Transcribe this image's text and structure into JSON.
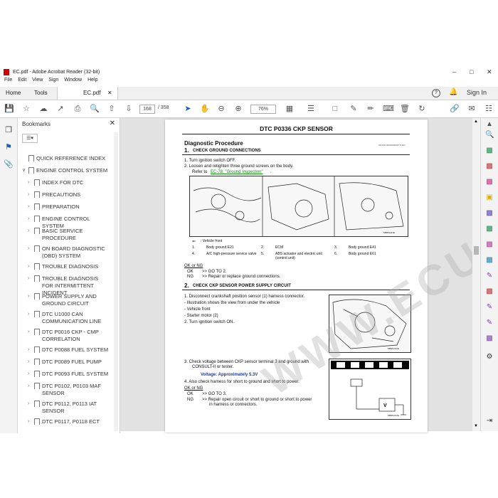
{
  "window": {
    "title": "EC.pdf - Adobe Acrobat Reader (32-bit)",
    "menu": [
      "File",
      "Edit",
      "View",
      "Sign",
      "Window",
      "Help"
    ]
  },
  "tabs": {
    "home": "Home",
    "tools": "Tools",
    "doc": "EC.pdf",
    "sign_in": "Sign In"
  },
  "toolbar": {
    "page_current": "168",
    "page_total": "/ 358",
    "zoom": "76%"
  },
  "bookmarks": {
    "header": "Bookmarks",
    "items": [
      {
        "label": "QUICK REFERENCE INDEX"
      },
      {
        "label": "ENGINE CONTROL SYSTEM"
      },
      {
        "label": "INDEX FOR DTC"
      },
      {
        "label": "PRECAUTIONS"
      },
      {
        "label": "PREPARATION"
      },
      {
        "label": "ENGINE CONTROL SYSTEM"
      },
      {
        "label": "BASIC SERVICE PROCEDURE"
      },
      {
        "label": "ON BOARD DIAGNOSTIC (OBD) SYSTEM"
      },
      {
        "label": "TROUBLE DIAGNOSIS"
      },
      {
        "label": "TROUBLE DIAGNOSIS FOR INTERMITTENT INCIDENT"
      },
      {
        "label": "POWER SUPPLY AND GROUND CIRCUIT"
      },
      {
        "label": "DTC U1000 CAN COMMUNICATION LINE"
      },
      {
        "label": "DTC P0016 CKP - CMP CORRELATION"
      },
      {
        "label": "DTC P0088 FUEL SYSTEM"
      },
      {
        "label": "DTC P0089 FUEL PUMP"
      },
      {
        "label": "DTC P0093 FUEL SYSTEM"
      },
      {
        "label": "DTC P0102, P0103 MAF SENSOR"
      },
      {
        "label": "DTC P0112, P0113 IAT SENSOR"
      },
      {
        "label": "DTC P0117, P0118 ECT"
      }
    ]
  },
  "page": {
    "title": "DTC P0336 CKP SENSOR",
    "section": "Diagnostic Procedure",
    "info_code": "INFOID:0000000005771467",
    "step1": {
      "num": "1.",
      "heading": "CHECK GROUND CONNECTIONS",
      "lines": [
        "1.   Turn ignition switch OFF.",
        "2.   Loosen and retighten three ground screws on the body.",
        "Refer to",
        "EC-78, \"Ground Inspection\"",
        "."
      ],
      "legend_front": ": Vehicle front",
      "legend": [
        [
          "1.",
          "Body ground E21",
          "2.",
          "ECM",
          "3.",
          "Body ground E41"
        ],
        [
          "4.",
          "A/C high-pressure service valve",
          "5.",
          "ABS actuator and electric unit (control unit)",
          "6.",
          "Body ground E61"
        ]
      ],
      "fig_code": "MBIB1221E",
      "ok_ng": "OK or NG",
      "ok": "OK",
      "ok_text": ">> GO TO 2.",
      "ng": "NG",
      "ng_text": ">> Repair or replace ground connections."
    },
    "step2": {
      "num": "2.",
      "heading": "CHECK CKP SENSOR POWER SUPPLY CIRCUIT",
      "lines": [
        "1.   Disconnect crankshaft position sensor (1) harness connector.",
        "-    Illustration shows the view from under the vehicle",
        "-    Vehicle front",
        "-    Starter motor (2)",
        "2.   Turn ignition switch ON."
      ],
      "fig_code": "MBIB1311E",
      "check": "3.   Check voltage between CKP sensor terminal 3 and ground with",
      "check2": "CONSULT-II or tester.",
      "voltage": "Voltage: Approximately 5.3V",
      "also": "4.   Also check harness for short to ground and short to power.",
      "ok_ng": "OK or NG",
      "ok": "OK",
      "ok_text": ">> GO TO 3.",
      "ng": "NG",
      "ng_text": ">> Repair open circuit or short to ground or short to power",
      "ng_text2": "in harness or connectors.",
      "fig2_code": "MBIB1312E"
    }
  },
  "watermark": "WWW.ECUDIAG.COM",
  "colors": {
    "link": "#118811",
    "voltage": "#1a3aa0",
    "sign_in": "#333333"
  }
}
